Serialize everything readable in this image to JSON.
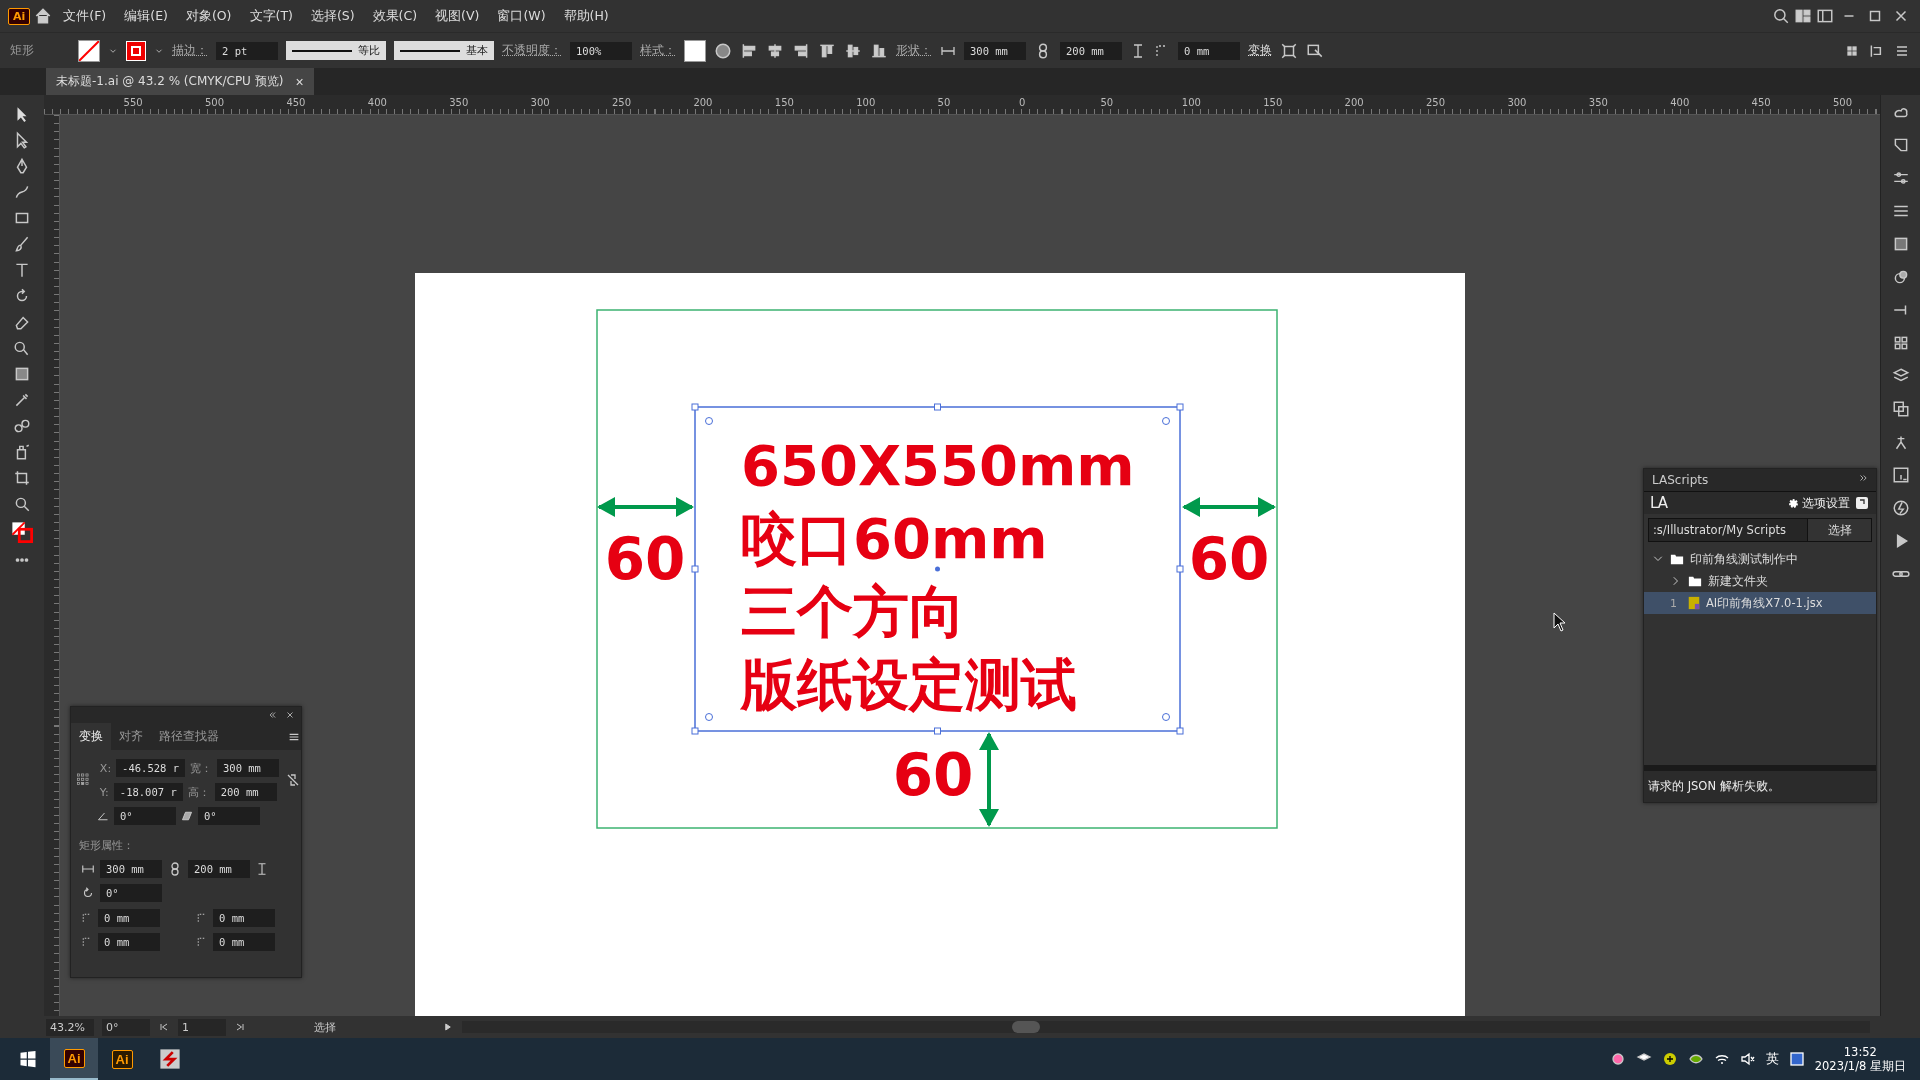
{
  "app_icon": "Ai",
  "menu": [
    "文件(F)",
    "编辑(E)",
    "对象(O)",
    "文字(T)",
    "选择(S)",
    "效果(C)",
    "视图(V)",
    "窗口(W)",
    "帮助(H)"
  ],
  "control_bar": {
    "tool_name": "矩形",
    "stroke_label": "描边：",
    "stroke_weight": "2 pt",
    "profile": "等比",
    "brush": "基本",
    "opacity_label": "不透明度：",
    "opacity": "100%",
    "style_label": "样式：",
    "shape_label": "形状：",
    "width": "300 mm",
    "height": "200 mm",
    "corner": "0 mm",
    "transform": "变换"
  },
  "document_tab": {
    "title": "未标题-1.ai @ 43.2 % (CMYK/CPU 预览)",
    "close": "×"
  },
  "ruler": {
    "labels": [
      "550",
      "500",
      "450",
      "400",
      "350",
      "300",
      "250",
      "200",
      "150",
      "100",
      "50",
      "0",
      "50",
      "100",
      "150",
      "200",
      "250",
      "300",
      "350",
      "400",
      "450",
      "500"
    ]
  },
  "artboard": {
    "lines": [
      "650X550mm",
      "咬口60mm",
      "三个方向",
      "版纸设定测试"
    ],
    "margins": [
      {
        "kind": "left",
        "label": "60"
      },
      {
        "kind": "right",
        "label": "60"
      },
      {
        "kind": "bottom",
        "label": "60"
      }
    ]
  },
  "transform_panel": {
    "tabs": [
      {
        "label": "变换",
        "selected": true
      },
      {
        "label": "对齐",
        "selected": false
      },
      {
        "label": "路径查找器",
        "selected": false
      }
    ],
    "x_label": "X:",
    "x": "-46.528 r",
    "w_label": "宽：",
    "w": "300 mm",
    "y_label": "Y:",
    "y": "-18.007 r",
    "h_label": "高：",
    "h": "200 mm",
    "angle": "0°",
    "shear": "0°",
    "rect_props": "矩形属性：",
    "rect_w": "300 mm",
    "rect_h": "200 mm",
    "rotation": "0°",
    "corners": [
      "0 mm",
      "0 mm",
      "0 mm",
      "0 mm"
    ]
  },
  "lascripts": {
    "title": "LAScripts",
    "logo": "LA",
    "settings": "选项设置",
    "path": ":s/Illustrator/My Scripts",
    "choose": "选择",
    "tree": [
      {
        "label": "印前角线测试制作中",
        "kind": "folder",
        "expanded": true,
        "selected": false,
        "children": [
          {
            "label": "新建文件夹",
            "kind": "folder",
            "expanded": false,
            "selected": false
          },
          {
            "label": "AI印前角线X7.0-1.jsx",
            "kind": "file",
            "number": "1",
            "selected": true
          }
        ]
      }
    ],
    "message": "请求的 JSON 解析失败。"
  },
  "status_bar": {
    "zoom": "43.2%",
    "rotation": "0°",
    "artboard": "1",
    "tool": "选择"
  },
  "taskbar": {
    "apps": [
      {
        "label": "Ai",
        "kind": "illustrator-dark",
        "selected": true
      },
      {
        "label": "Ai",
        "kind": "illustrator",
        "selected": false
      },
      {
        "kind": "script",
        "selected": false
      }
    ],
    "ime": "英",
    "time": "13:52",
    "date": "2023/1/8 星期日"
  }
}
